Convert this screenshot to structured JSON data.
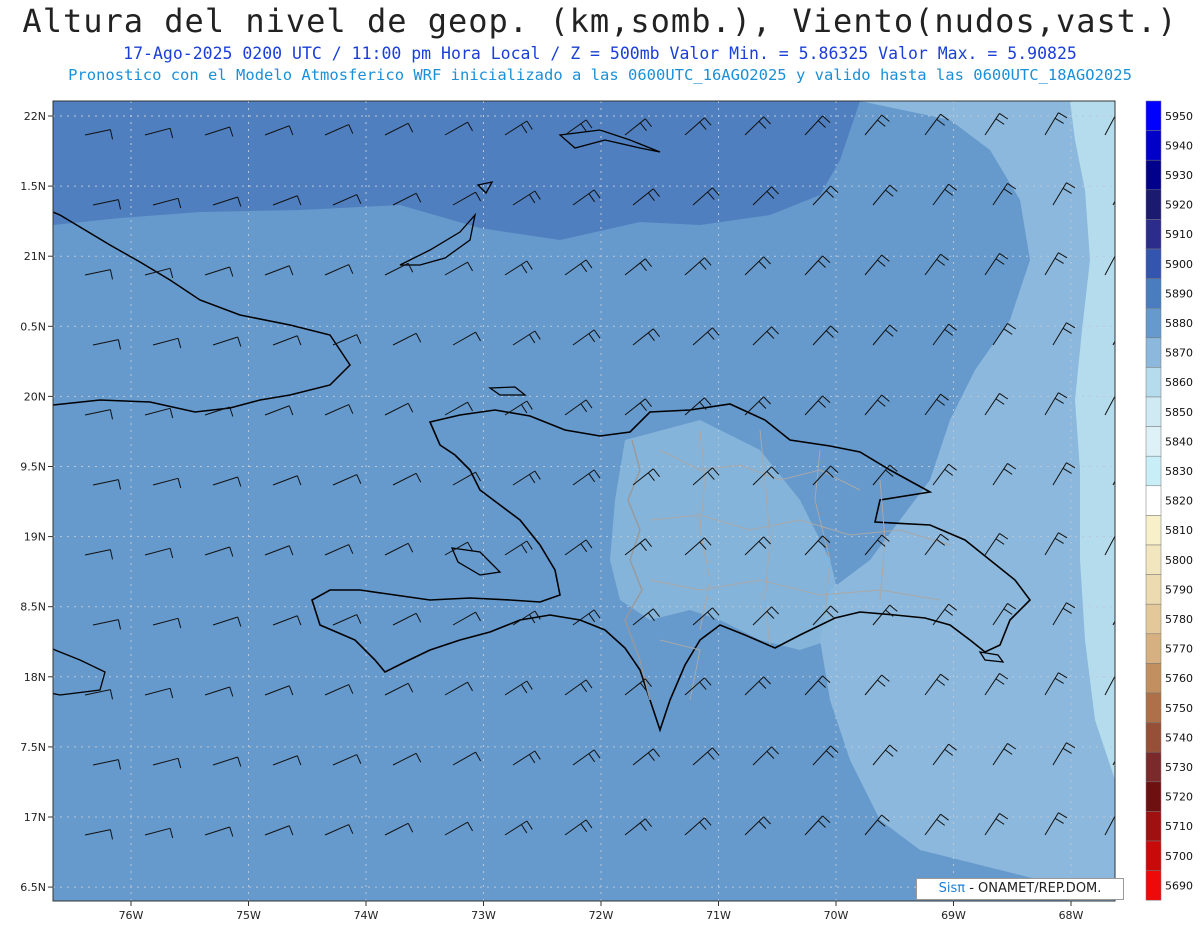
{
  "header": {
    "title": "Altura del nivel de geop. (km,somb.), Viento(nudos,vast.)",
    "subtitle": "17-Ago-2025  0200 UTC / 11:00 pm Hora Local / Z = 500mb   Valor Min. = 5.86325  Valor Max. = 5.90825",
    "subtitle2": "Pronostico con el Modelo Atmosferico WRF inicializado a las 0600UTC_16AGO2025 y valido hasta las  0600UTC_18AGO2025"
  },
  "axes": {
    "lat_labels": [
      "22N",
      "1.5N",
      "21N",
      "0.5N",
      "20N",
      "9.5N",
      "19N",
      "8.5N",
      "18N",
      "7.5N",
      "17N",
      "6.5N"
    ],
    "lon_labels": [
      "76W",
      "75W",
      "74W",
      "73W",
      "72W",
      "71W",
      "70W",
      "69W",
      "68W"
    ]
  },
  "colorbar": {
    "labels": [
      "5950",
      "5940",
      "5930",
      "5920",
      "5910",
      "5900",
      "5890",
      "5880",
      "5870",
      "5860",
      "5850",
      "5840",
      "5830",
      "5820",
      "5810",
      "5800",
      "5790",
      "5780",
      "5770",
      "5760",
      "5750",
      "5740",
      "5730",
      "5720",
      "5710",
      "5700",
      "5690"
    ],
    "colors": [
      "#0000ff",
      "#0000c8",
      "#00008c",
      "#1a1a70",
      "#2c2c8c",
      "#3355b0",
      "#4a7cc0",
      "#6699cc",
      "#8bb8dc",
      "#b5dcec",
      "#cfeaf3",
      "#ddf1f7",
      "#c8eff8",
      "#ffffff",
      "#f8f0c8",
      "#f2e6bf",
      "#ecdab0",
      "#e4c89a",
      "#d6b080",
      "#c29060",
      "#ad7048",
      "#965038",
      "#7a2a2a",
      "#6e1010",
      "#a01010",
      "#c80a0a",
      "#ee0a0a"
    ]
  },
  "credit": {
    "brand": "Sisπ",
    "org": "- ONAMET/REP.DOM."
  },
  "colors": {
    "ocean_base": "#6699cc",
    "north_band": "#4f7fbf",
    "east_light": "#8bb8dc",
    "east_lighter": "#b5dcec",
    "coast": "#000000",
    "border": "#999999"
  },
  "icons": {
    "wind": "wind-barb-icon"
  }
}
